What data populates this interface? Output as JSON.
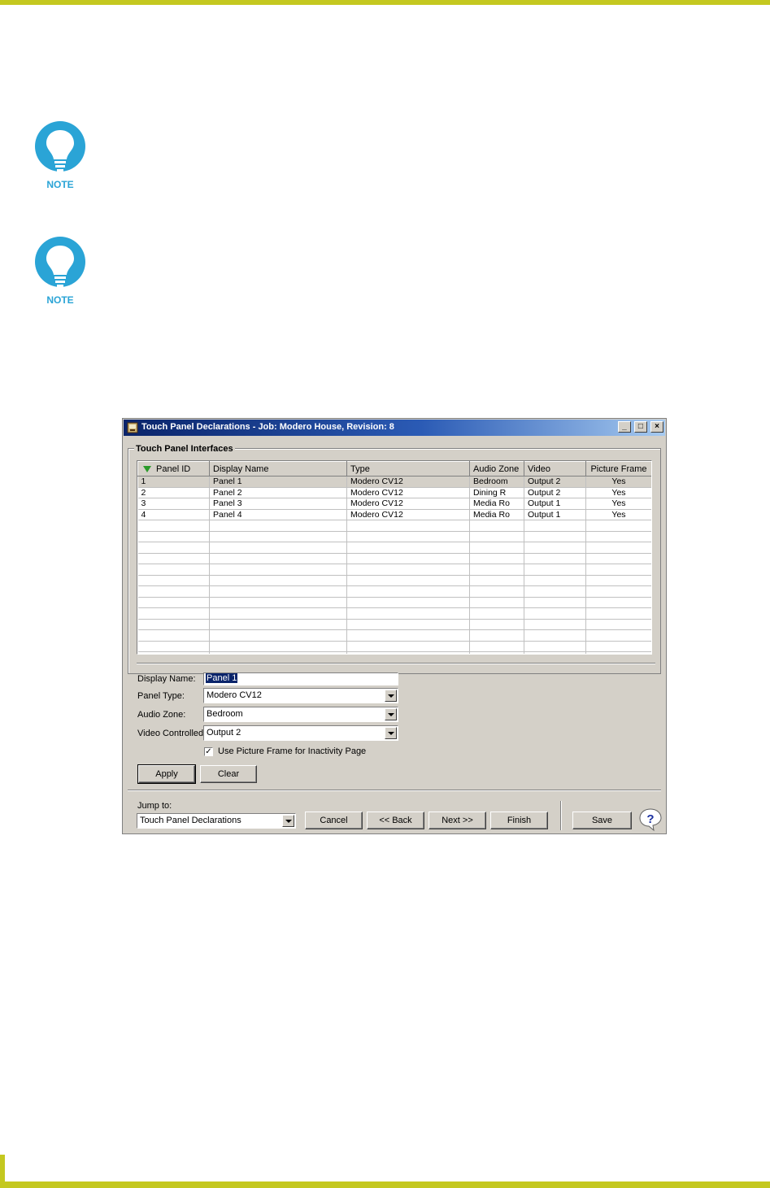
{
  "notes": [
    {
      "label": "NOTE"
    },
    {
      "label": "NOTE"
    }
  ],
  "window": {
    "title": "Touch Panel Declarations - Job: Modero House, Revision: 8",
    "controls": {
      "minimize": "_",
      "maximize": "□",
      "close": "×"
    }
  },
  "group": {
    "label": "Touch Panel Interfaces"
  },
  "grid": {
    "columns": [
      "Panel ID",
      "Display Name",
      "Type",
      "Audio Zone",
      "Video",
      "Picture Frame"
    ],
    "rows": [
      [
        "1",
        "Panel 1",
        "Modero CV12",
        "Bedroom",
        "Output 2",
        "Yes"
      ],
      [
        "2",
        "Panel 2",
        "Modero CV12",
        "Dining R",
        "Output 2",
        "Yes"
      ],
      [
        "3",
        "Panel 3",
        "Modero CV12",
        "Media Ro",
        "Output 1",
        "Yes"
      ],
      [
        "4",
        "Panel 4",
        "Modero CV12",
        "Media Ro",
        "Output 1",
        "Yes"
      ]
    ],
    "selected_row": 0,
    "empty_rows": 13
  },
  "form": {
    "display_name_label": "Display Name:",
    "display_name_value": "Panel 1",
    "panel_type_label": "Panel Type:",
    "panel_type_value": "Modero CV12",
    "audio_zone_label": "Audio Zone:",
    "audio_zone_value": "Bedroom",
    "video_label": "Video Controlled:",
    "video_value": "Output 2",
    "checkbox_label": "Use Picture Frame for Inactivity Page",
    "checkbox_checked": true,
    "checkbox_mark": "✓",
    "apply_label": "Apply",
    "clear_label": "Clear"
  },
  "footer": {
    "jump_label": "Jump to:",
    "jump_value": "Touch Panel Declarations",
    "cancel_label": "Cancel",
    "back_label": "<< Back",
    "next_label": "Next >>",
    "finish_label": "Finish",
    "save_label": "Save",
    "help_glyph": "?"
  }
}
